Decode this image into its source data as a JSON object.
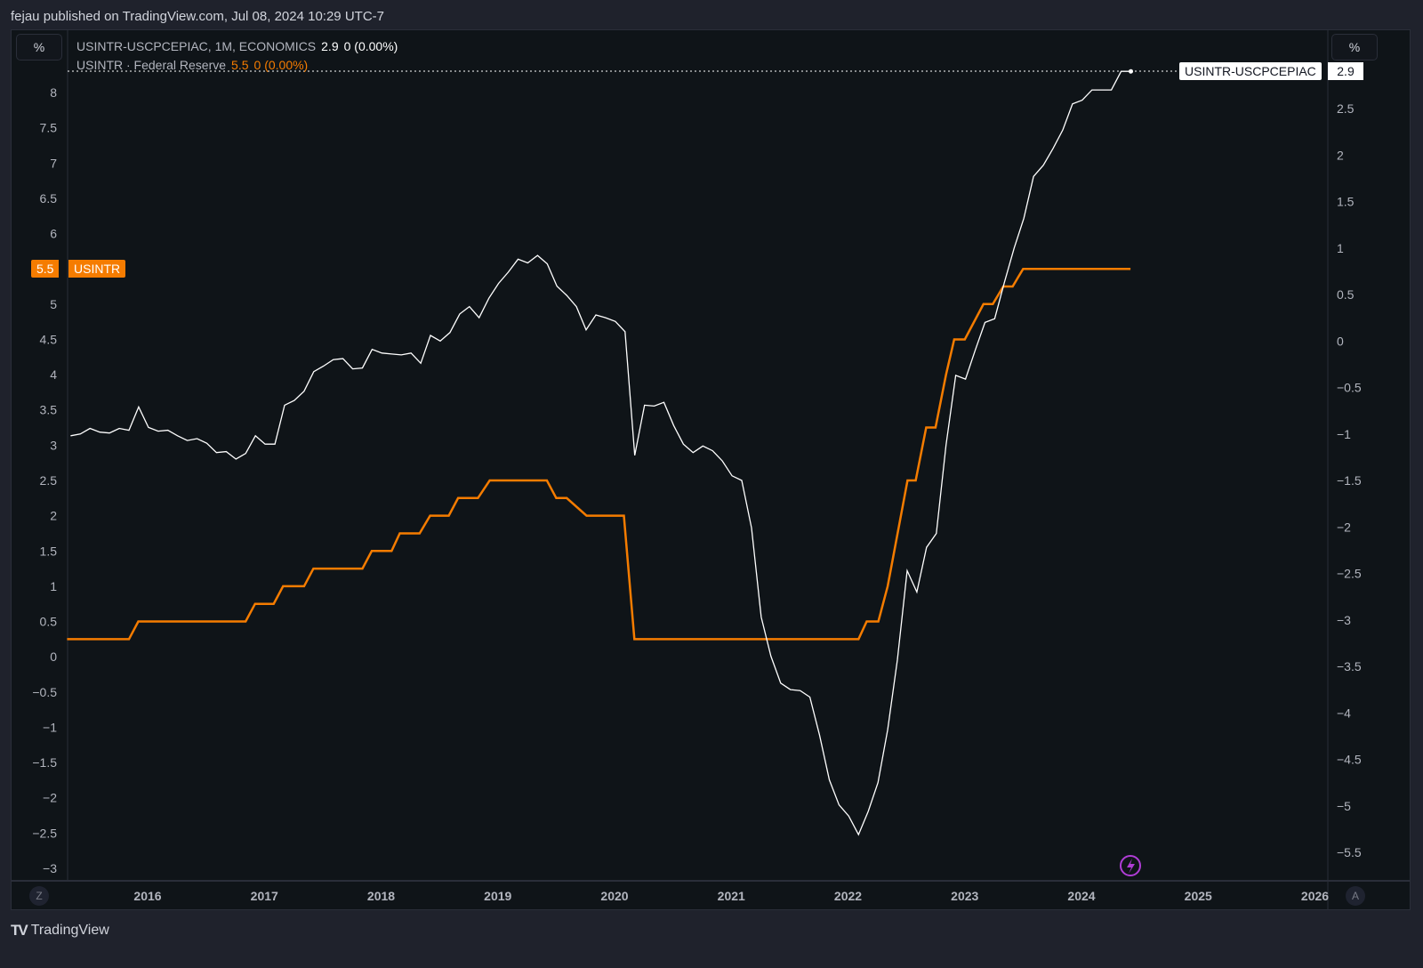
{
  "header": {
    "published": "fejau published on TradingView.com, Jul 08, 2024 10:29 UTC-7"
  },
  "scale_left_label": "%",
  "scale_right_label": "%",
  "legend": {
    "series1_name": "USINTR-USCPCEPIAC, 1M, ECONOMICS",
    "series1_value": "2.9",
    "series1_change": "0 (0.00%)",
    "series2_name": "USINTR · Federal Reserve",
    "series2_value": "5.5",
    "series2_change": "0 (0.00%)"
  },
  "tags": {
    "left_value": "5.5",
    "left_name": "USINTR",
    "right_name": "USINTR-USCPCEPIAC",
    "right_value": "2.9"
  },
  "axis_buttons": {
    "left": "Z",
    "right": "A"
  },
  "brand": "TradingView",
  "colors": {
    "series1": "#ffffff",
    "series2": "#f57c00",
    "event": "#b03dd6"
  },
  "chart_data": {
    "type": "line",
    "title": "USINTR-USCPCEPIAC vs USINTR",
    "x_ticks": [
      "2016",
      "2017",
      "2018",
      "2019",
      "2020",
      "2021",
      "2022",
      "2023",
      "2024",
      "2025",
      "2026"
    ],
    "xlim": [
      2015.31,
      2026.1
    ],
    "left_axis": {
      "ylim": [
        -3,
        8
      ],
      "ticks": [
        "8",
        "7.5",
        "7",
        "6.5",
        "6",
        "5.5",
        "5",
        "4.5",
        "4",
        "3.5",
        "3",
        "2.5",
        "2",
        "1.5",
        "1",
        "0.5",
        "0",
        "−0.5",
        "−1",
        "−1.5",
        "−2",
        "−2.5",
        "−3"
      ]
    },
    "right_axis": {
      "ylim": [
        -5.5,
        2.5
      ],
      "ticks": [
        "2.5",
        "2",
        "1.5",
        "1",
        "0.5",
        "0",
        "−0.5",
        "−1",
        "−1.5",
        "−2",
        "−2.5",
        "−3",
        "−3.5",
        "−4",
        "−4.5",
        "−5",
        "−5.5"
      ]
    },
    "series": [
      {
        "name": "USINTR-USCPCEPIAC",
        "axis": "right",
        "x_start": 2015.34,
        "step_years": 0.08333,
        "values": [
          -1.02,
          -1.0,
          -0.94,
          -0.98,
          -0.99,
          -0.94,
          -0.96,
          -0.71,
          -0.93,
          -0.97,
          -0.96,
          -1.02,
          -1.07,
          -1.05,
          -1.1,
          -1.2,
          -1.19,
          -1.27,
          -1.21,
          -1.02,
          -1.11,
          -1.11,
          -0.69,
          -0.64,
          -0.54,
          -0.33,
          -0.27,
          -0.2,
          -0.19,
          -0.3,
          -0.29,
          -0.09,
          -0.13,
          -0.14,
          -0.15,
          -0.13,
          -0.24,
          0.06,
          0.0,
          0.09,
          0.29,
          0.37,
          0.25,
          0.46,
          0.62,
          0.74,
          0.88,
          0.84,
          0.92,
          0.83,
          0.59,
          0.49,
          0.37,
          0.12,
          0.28,
          0.25,
          0.21,
          0.1,
          -1.23,
          -0.69,
          -0.7,
          -0.66,
          -0.91,
          -1.11,
          -1.2,
          -1.13,
          -1.18,
          -1.29,
          -1.45,
          -1.5,
          -2.01,
          -2.97,
          -3.39,
          -3.68,
          -3.75,
          -3.76,
          -3.83,
          -4.24,
          -4.72,
          -4.99,
          -5.11,
          -5.31,
          -5.06,
          -4.75,
          -4.18,
          -3.43,
          -2.47,
          -2.7,
          -2.22,
          -2.07,
          -1.12,
          -0.37,
          -0.41,
          -0.1,
          0.2,
          0.24,
          0.63,
          1.0,
          1.32,
          1.77,
          1.89,
          2.07,
          2.27,
          2.55,
          2.59,
          2.7,
          2.7,
          2.7,
          2.9,
          2.9
        ]
      },
      {
        "name": "USINTR",
        "axis": "left",
        "points": [
          [
            2015.31,
            0.25
          ],
          [
            2015.84,
            0.25
          ],
          [
            2015.92,
            0.5
          ],
          [
            2016.84,
            0.5
          ],
          [
            2016.92,
            0.75
          ],
          [
            2017.08,
            0.75
          ],
          [
            2017.16,
            1.0
          ],
          [
            2017.34,
            1.0
          ],
          [
            2017.42,
            1.25
          ],
          [
            2017.84,
            1.25
          ],
          [
            2017.92,
            1.5
          ],
          [
            2018.09,
            1.5
          ],
          [
            2018.16,
            1.75
          ],
          [
            2018.33,
            1.75
          ],
          [
            2018.42,
            2.0
          ],
          [
            2018.58,
            2.0
          ],
          [
            2018.66,
            2.25
          ],
          [
            2018.83,
            2.25
          ],
          [
            2018.93,
            2.5
          ],
          [
            2019.42,
            2.5
          ],
          [
            2019.5,
            2.25
          ],
          [
            2019.59,
            2.25
          ],
          [
            2019.76,
            2.0
          ],
          [
            2020.08,
            2.0
          ],
          [
            2020.17,
            0.25
          ],
          [
            2022.09,
            0.25
          ],
          [
            2022.16,
            0.5
          ],
          [
            2022.26,
            0.5
          ],
          [
            2022.34,
            1.0
          ],
          [
            2022.51,
            2.5
          ],
          [
            2022.58,
            2.5
          ],
          [
            2022.67,
            3.25
          ],
          [
            2022.75,
            3.25
          ],
          [
            2022.84,
            4.0
          ],
          [
            2022.91,
            4.5
          ],
          [
            2023.0,
            4.5
          ],
          [
            2023.16,
            5.0
          ],
          [
            2023.24,
            5.0
          ],
          [
            2023.33,
            5.25
          ],
          [
            2023.41,
            5.25
          ],
          [
            2023.5,
            5.5
          ],
          [
            2024.42,
            5.5
          ]
        ]
      }
    ]
  }
}
